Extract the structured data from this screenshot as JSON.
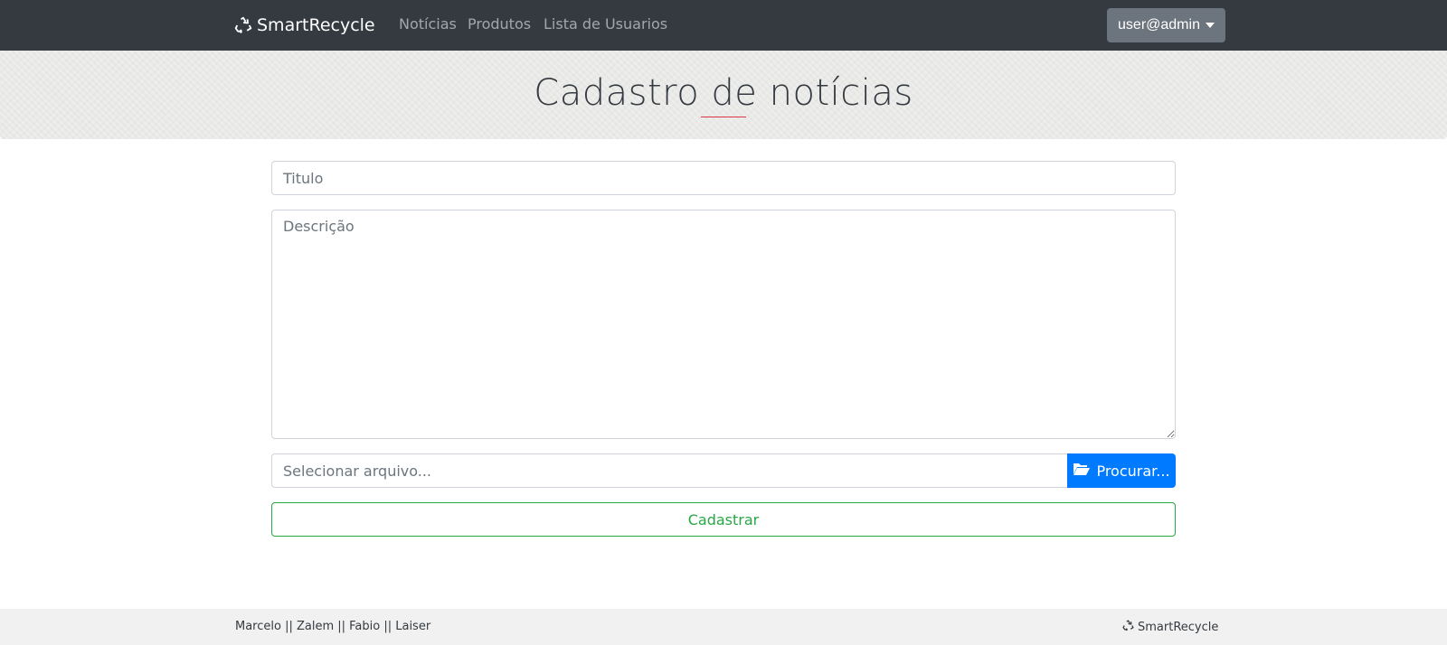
{
  "navbar": {
    "brand": "SmartRecycle",
    "brand_icon": "recycle-icon",
    "links": [
      {
        "label": "Notícias"
      },
      {
        "label": "Produtos"
      },
      {
        "label": "Lista de Usuarios"
      }
    ],
    "user_menu": "user@admin"
  },
  "hero": {
    "title": "Cadastro de notícias"
  },
  "form": {
    "title_placeholder": "Titulo",
    "description_placeholder": "Descrição",
    "file_placeholder": "Selecionar arquivo...",
    "browse_label": "Procurar...",
    "browse_icon": "folder-open-icon",
    "submit_label": "Cadastrar"
  },
  "footer": {
    "authors": "Marcelo || Zalem || Fabio || Laiser",
    "brand": "SmartRecycle",
    "brand_icon": "recycle-icon"
  },
  "colors": {
    "navbar_bg": "#343a40",
    "primary": "#007bff",
    "success": "#28a745",
    "accent_underline": "#dc3545",
    "secondary": "#6c757d"
  }
}
